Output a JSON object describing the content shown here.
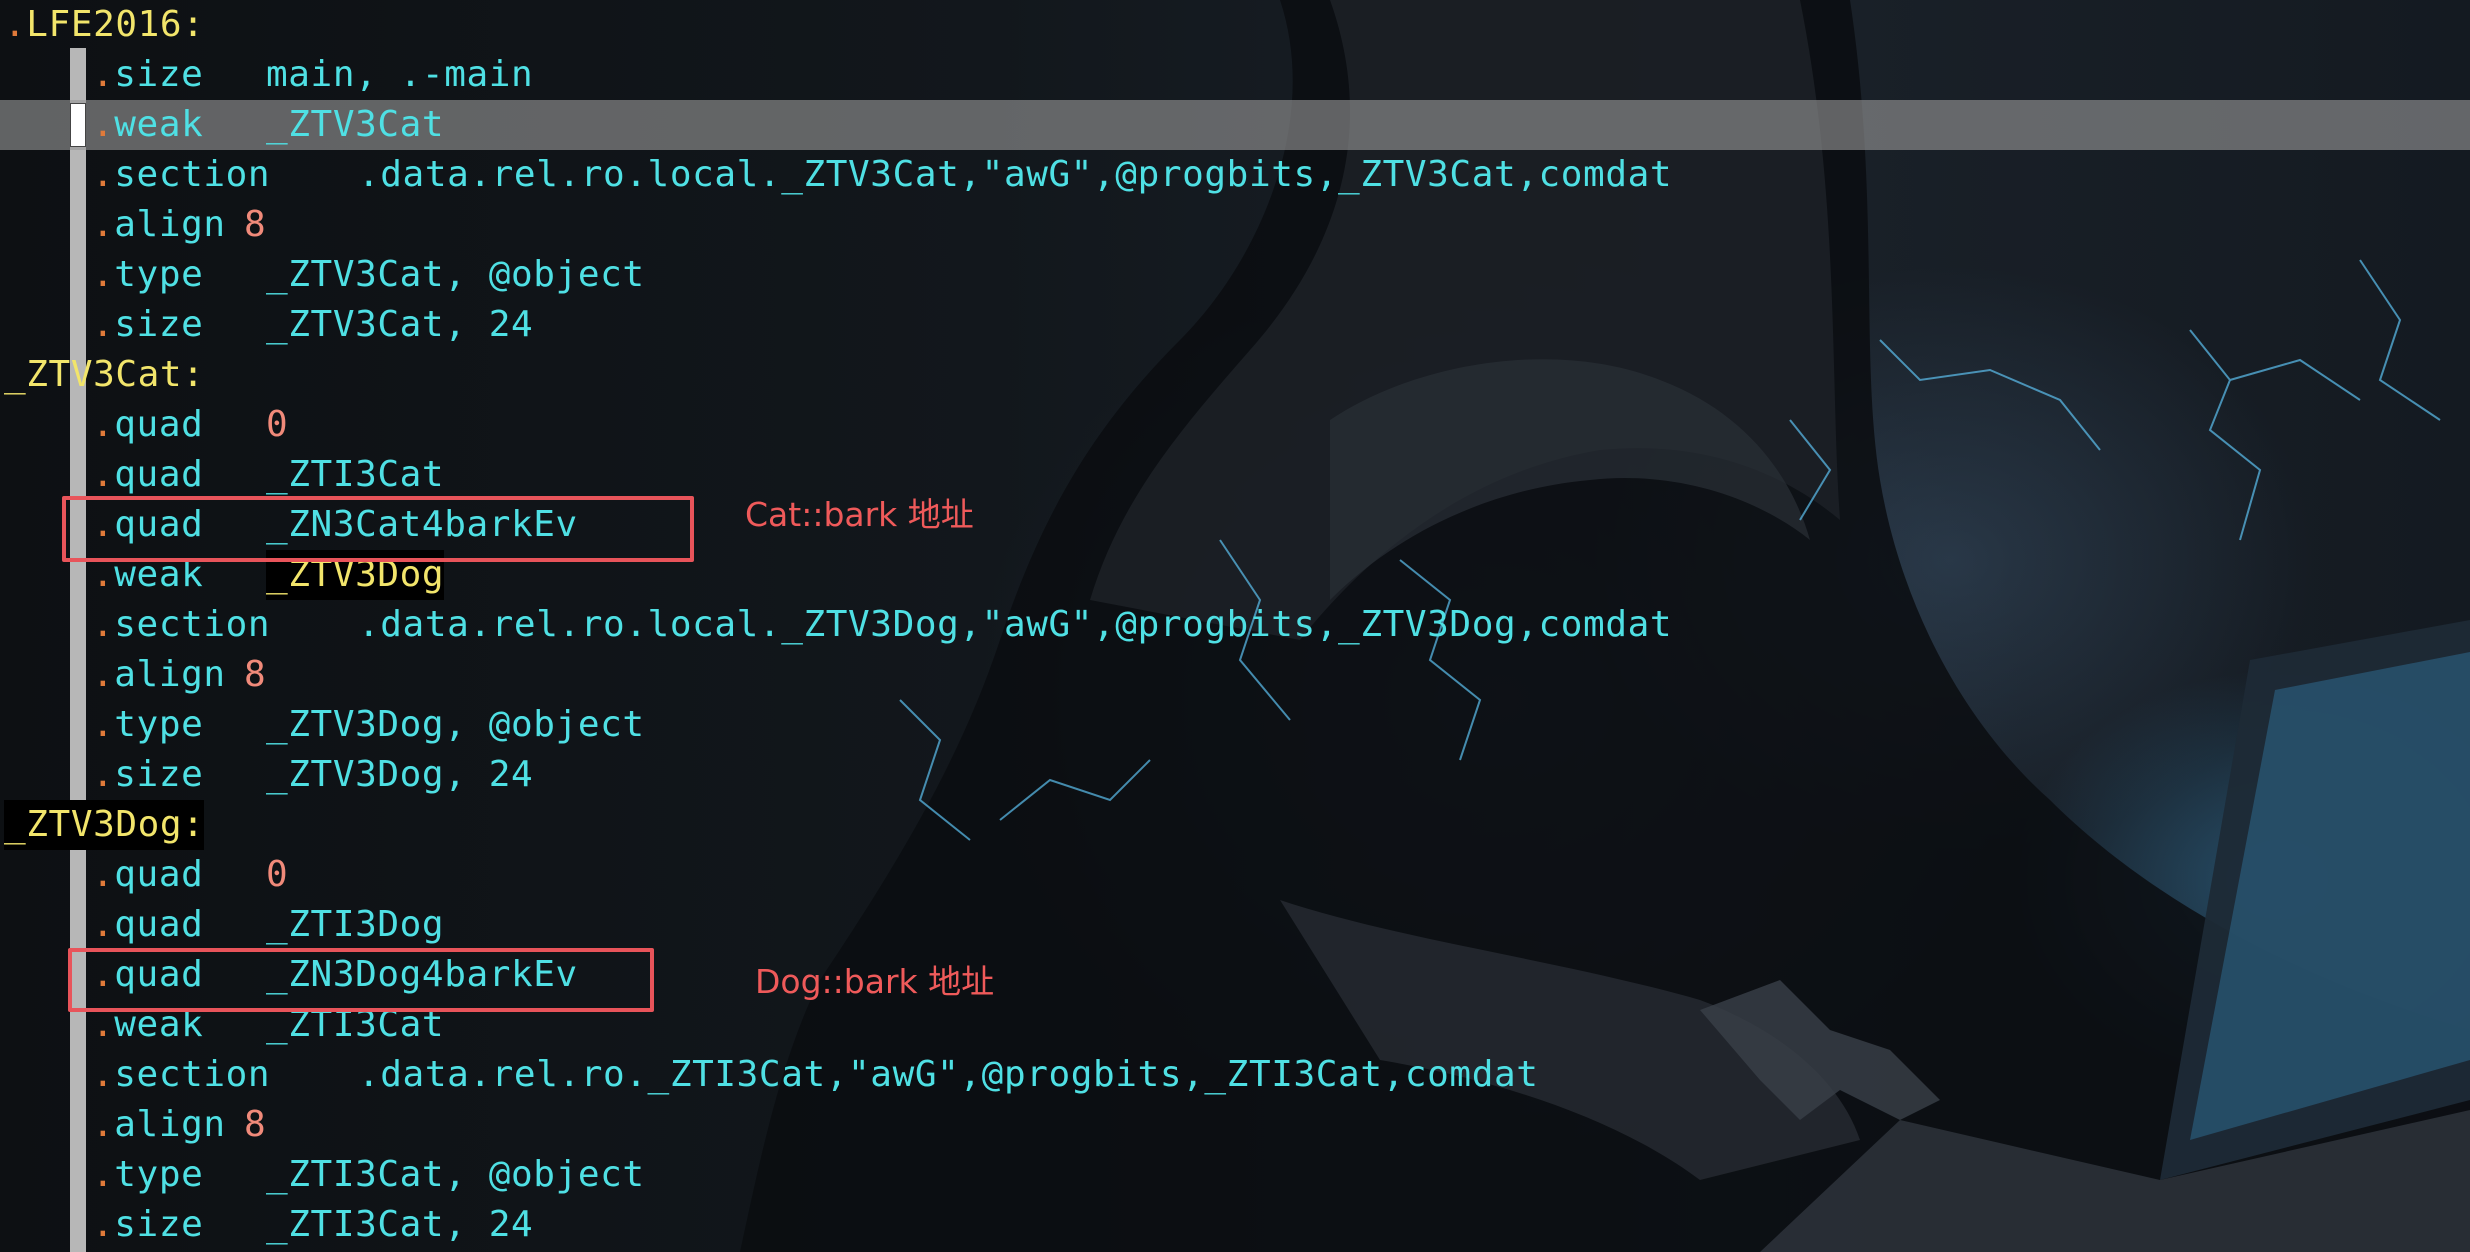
{
  "lines": [
    {
      "label": ".LFE2016:"
    },
    {
      "mnemonic": ".size",
      "operand": "main, .-main"
    },
    {
      "mnemonic": ".weak",
      "operand": "_ZTV3Cat"
    },
    {
      "mnemonic": ".section",
      "operand": ".data.rel.ro.local._ZTV3Cat,\"awG\",@progbits,_ZTV3Cat,comdat"
    },
    {
      "mnemonic": ".align",
      "operand": "8"
    },
    {
      "mnemonic": ".type",
      "operand": "_ZTV3Cat, @object"
    },
    {
      "mnemonic": ".size",
      "operand": "_ZTV3Cat, 24"
    },
    {
      "label": "_ZTV3Cat:"
    },
    {
      "mnemonic": ".quad",
      "operand": "0"
    },
    {
      "mnemonic": ".quad",
      "operand": "_ZTI3Cat"
    },
    {
      "mnemonic": ".quad",
      "operand": "_ZN3Cat4barkEv"
    },
    {
      "mnemonic": ".weak",
      "operand": "_ZTV3Dog"
    },
    {
      "mnemonic": ".section",
      "operand": ".data.rel.ro.local._ZTV3Dog,\"awG\",@progbits,_ZTV3Dog,comdat"
    },
    {
      "mnemonic": ".align",
      "operand": "8"
    },
    {
      "mnemonic": ".type",
      "operand": "_ZTV3Dog, @object"
    },
    {
      "mnemonic": ".size",
      "operand": "_ZTV3Dog, 24"
    },
    {
      "label": "_ZTV3Dog:"
    },
    {
      "mnemonic": ".quad",
      "operand": "0"
    },
    {
      "mnemonic": ".quad",
      "operand": "_ZTI3Dog"
    },
    {
      "mnemonic": ".quad",
      "operand": "_ZN3Dog4barkEv"
    },
    {
      "mnemonic": ".weak",
      "operand": "_ZTI3Cat"
    },
    {
      "mnemonic": ".section",
      "operand": ".data.rel.ro._ZTI3Cat,\"awG\",@progbits,_ZTI3Cat,comdat"
    },
    {
      "mnemonic": ".align",
      "operand": "8"
    },
    {
      "mnemonic": ".type",
      "operand": "_ZTI3Cat, @object"
    },
    {
      "mnemonic": ".size",
      "operand": "_ZTI3Cat, 24"
    }
  ],
  "current_line": 3,
  "search_highlight": "_ZTV3Dog",
  "annotations": [
    {
      "text": "Cat::bark 地址"
    },
    {
      "text": "Dog::bark 地址"
    }
  ],
  "colors": {
    "directive_dot": "#e07a3a",
    "keyword": "#4fe0e4",
    "label": "#f2e56b",
    "number": "#f08a7a",
    "annotation": "#e8545a"
  }
}
